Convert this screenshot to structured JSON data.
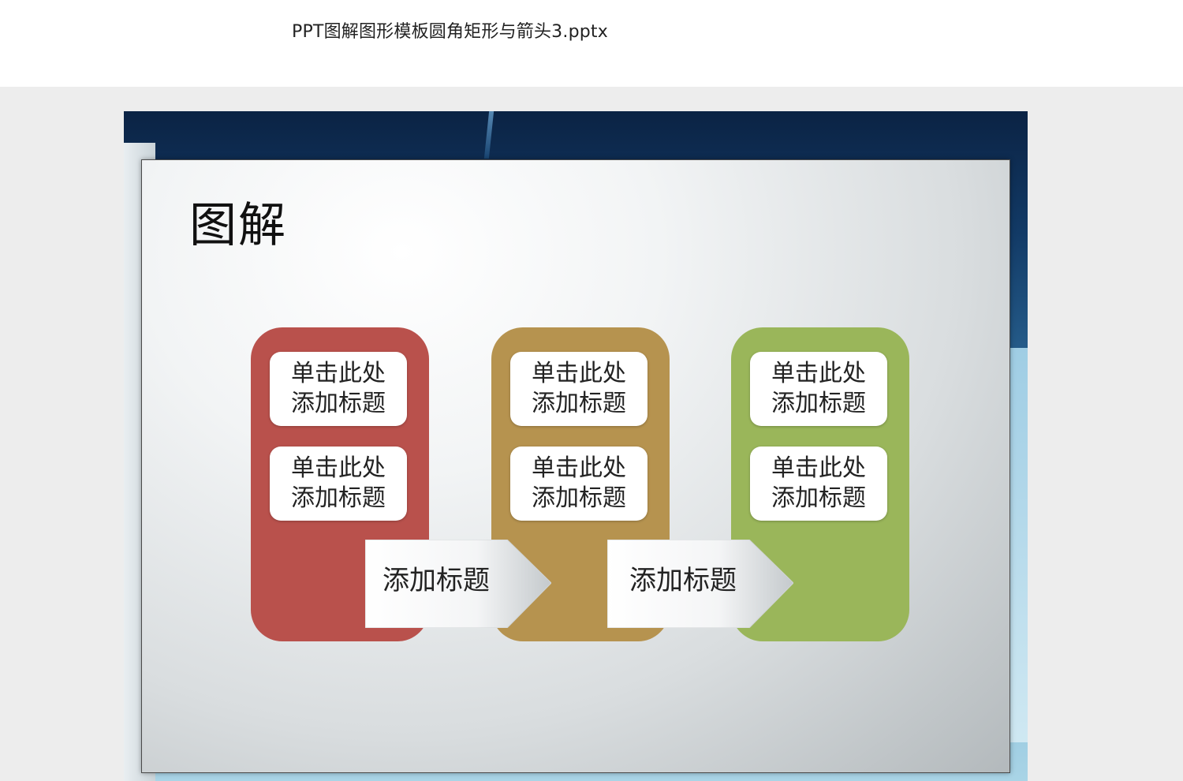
{
  "document": {
    "filename": "PPT图解图形模板圆角矩形与箭头3.pptx"
  },
  "slide": {
    "title": "图解",
    "columns": [
      {
        "color": "#b9514c",
        "top_label": "单击此处\n添加标题",
        "bottom_label": "单击此处\n添加标题"
      },
      {
        "color": "#b6934f",
        "top_label": "单击此处\n添加标题",
        "bottom_label": "单击此处\n添加标题"
      },
      {
        "color": "#9ab65a",
        "top_label": "单击此处\n添加标题",
        "bottom_label": "单击此处\n添加标题"
      }
    ],
    "arrows": [
      {
        "label": "添加标题"
      },
      {
        "label": "添加标题"
      }
    ]
  }
}
